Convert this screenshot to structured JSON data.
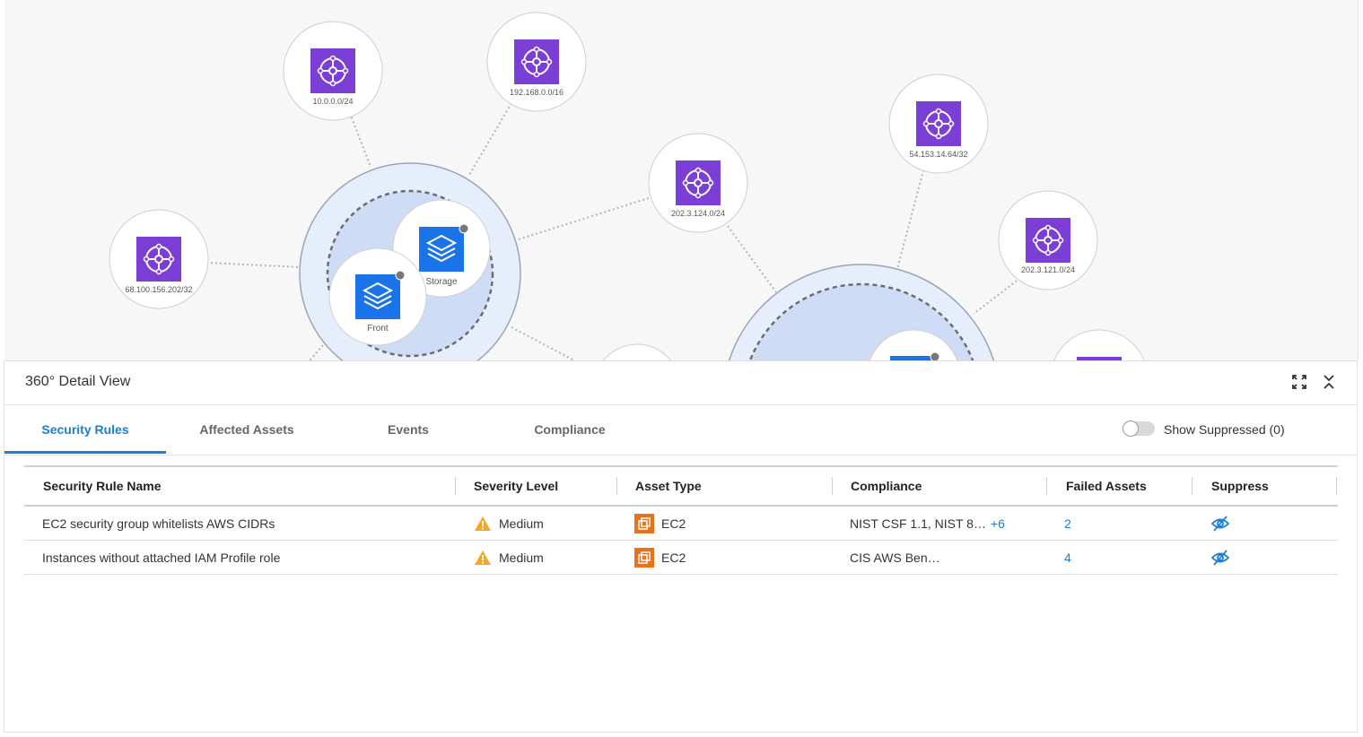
{
  "graph": {
    "nodes": [
      {
        "label": "10.0.0.0/24",
        "icon": "network-hub-icon"
      },
      {
        "label": "192.168.0.0/16",
        "icon": "network-hub-icon"
      },
      {
        "label": "68.100.156.202/32",
        "icon": "network-hub-icon"
      },
      {
        "label": "202.3.124.0/24",
        "icon": "network-hub-icon"
      },
      {
        "label": "54.153.14.64/32",
        "icon": "network-hub-icon"
      },
      {
        "label": "202.3.121.0/24",
        "icon": "network-hub-icon"
      }
    ],
    "groups": [
      {
        "label": "Storage",
        "icon": "layers-icon"
      },
      {
        "label": "Front",
        "icon": "layers-icon"
      }
    ],
    "colors": {
      "node_purple": "#7b3fd6",
      "group_blue": "#1a73e8",
      "halo": "#dfe8f8"
    }
  },
  "panel": {
    "title": "360° Detail View",
    "expand_icon": "expand-icon",
    "collapse_icon": "collapse-icon",
    "tabs": [
      {
        "label": "Security Rules",
        "active": true
      },
      {
        "label": "Affected Assets",
        "active": false
      },
      {
        "label": "Events",
        "active": false
      },
      {
        "label": "Compliance",
        "active": false
      }
    ],
    "show_suppressed_label": "Show Suppressed (0)",
    "show_suppressed_on": false
  },
  "table": {
    "columns": [
      "Security Rule Name",
      "Severity Level",
      "Asset Type",
      "Compliance",
      "Failed Assets",
      "Suppress"
    ],
    "rows": [
      {
        "name": "EC2 security group whitelists AWS CIDRs",
        "severity": "Medium",
        "asset_type": "EC2",
        "compliance": "NIST CSF 1.1, NIST 8…",
        "compliance_more": "+6",
        "failed_assets": "2"
      },
      {
        "name": "Instances without attached IAM Profile role",
        "severity": "Medium",
        "asset_type": "EC2",
        "compliance": "CIS AWS Ben…",
        "compliance_more": "",
        "failed_assets": "4"
      }
    ],
    "colors": {
      "warning": "#f5a623",
      "ec2": "#e8731a",
      "link": "#1a7fd6"
    }
  }
}
